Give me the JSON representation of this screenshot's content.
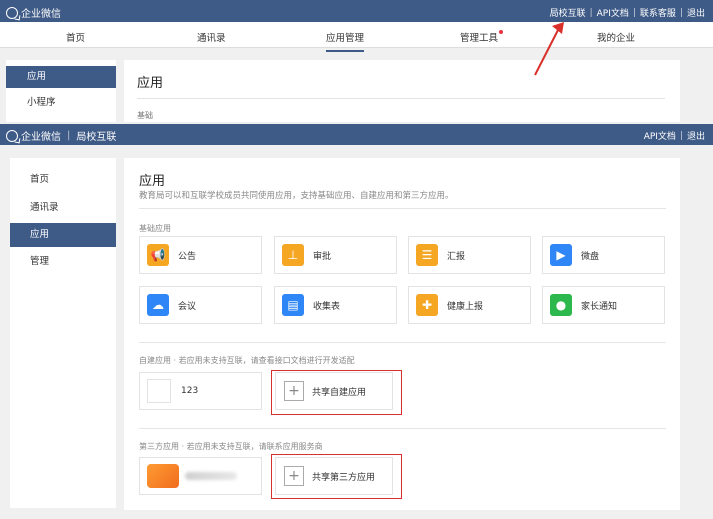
{
  "top": {
    "brand": "企业微信",
    "links": [
      "局校互联",
      "API文档",
      "联系客服",
      "退出"
    ],
    "nav": [
      "首页",
      "通讯录",
      "应用管理",
      "管理工具",
      "我的企业"
    ],
    "side": [
      "应用",
      "小程序"
    ],
    "title": "应用",
    "cut_label": "基础"
  },
  "overlay": {
    "brand": "企业微信",
    "brand_sub": "局校互联",
    "links": [
      "API文档",
      "退出"
    ],
    "side": [
      "首页",
      "通讯录",
      "应用",
      "管理"
    ],
    "title": "应用",
    "desc": "教育局可以和互联学校成员共同使用应用，支持基础应用、自建应用和第三方应用。",
    "basic_label": "基础应用",
    "basic_apps": [
      {
        "name": "公告",
        "icon": "megaphone-icon",
        "color": "#f5a623"
      },
      {
        "name": "审批",
        "icon": "stamp-icon",
        "color": "#f5a623"
      },
      {
        "name": "汇报",
        "icon": "report-icon",
        "color": "#f5a623"
      },
      {
        "name": "微盘",
        "icon": "drive-icon",
        "color": "#2f86f6"
      },
      {
        "name": "会议",
        "icon": "cloud-icon",
        "color": "#2f86f6"
      },
      {
        "name": "收集表",
        "icon": "form-icon",
        "color": "#2f86f6"
      },
      {
        "name": "健康上报",
        "icon": "health-icon",
        "color": "#f5a623"
      },
      {
        "name": "家长通知",
        "icon": "chat-icon",
        "color": "#2db84d"
      }
    ],
    "custom_label": "自建应用 · 若应用未支持互联，请查看接口文档进行开发适配",
    "custom_app": "123",
    "share_custom": "共享自建应用",
    "third_label": "第三方应用 · 若应用未支持互联，请联系应用服务商",
    "share_third": "共享第三方应用"
  }
}
